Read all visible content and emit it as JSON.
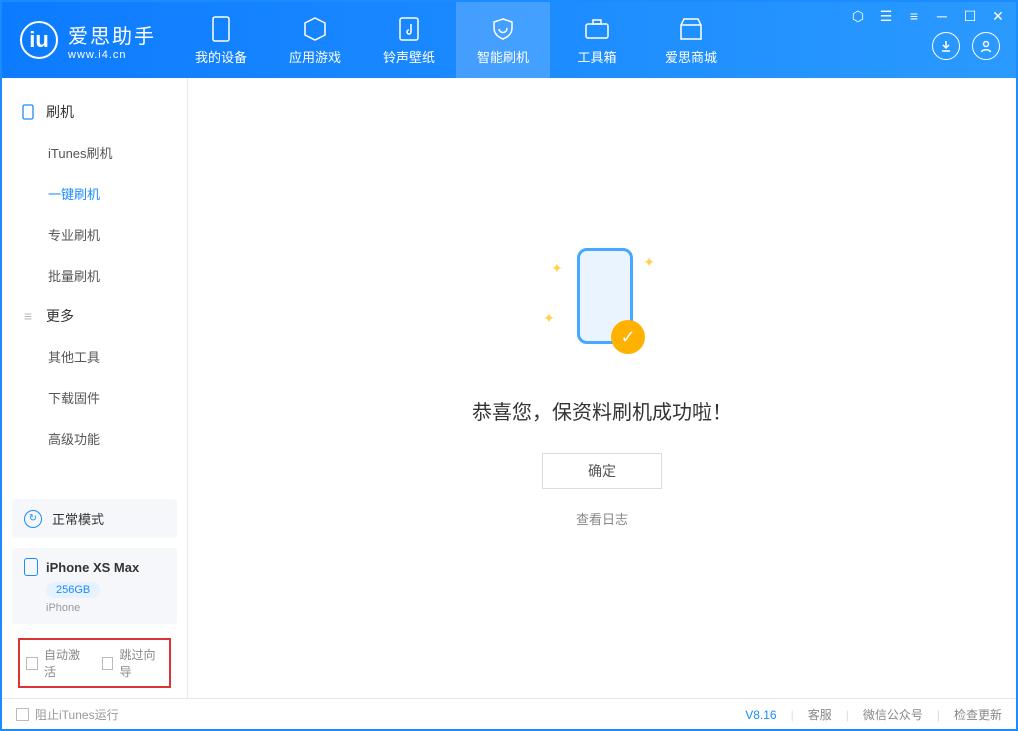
{
  "brand": {
    "name": "爱思助手",
    "url": "www.i4.cn"
  },
  "tabs": [
    {
      "label": "我的设备"
    },
    {
      "label": "应用游戏"
    },
    {
      "label": "铃声壁纸"
    },
    {
      "label": "智能刷机"
    },
    {
      "label": "工具箱"
    },
    {
      "label": "爱思商城"
    }
  ],
  "sidebar": {
    "flash_head": "刷机",
    "flash_items": [
      "iTunes刷机",
      "一键刷机",
      "专业刷机",
      "批量刷机"
    ],
    "more_head": "更多",
    "more_items": [
      "其他工具",
      "下载固件",
      "高级功能"
    ]
  },
  "status": {
    "mode": "正常模式"
  },
  "device": {
    "name": "iPhone XS Max",
    "capacity": "256GB",
    "type": "iPhone"
  },
  "options": {
    "auto_activate": "自动激活",
    "skip_wizard": "跳过向导"
  },
  "main": {
    "message": "恭喜您，保资料刷机成功啦！",
    "confirm": "确定",
    "view_log": "查看日志"
  },
  "footer": {
    "block_itunes": "阻止iTunes运行",
    "version": "V8.16",
    "links": [
      "客服",
      "微信公众号",
      "检查更新"
    ]
  }
}
